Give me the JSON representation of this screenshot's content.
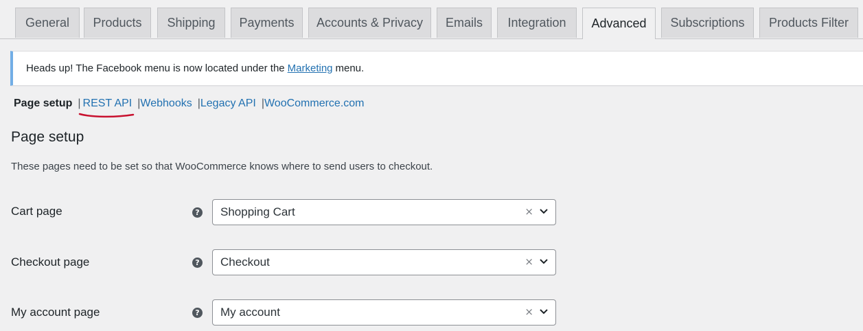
{
  "tabs": [
    {
      "label": "General"
    },
    {
      "label": "Products"
    },
    {
      "label": "Shipping"
    },
    {
      "label": "Payments"
    },
    {
      "label": "Accounts & Privacy"
    },
    {
      "label": "Emails"
    },
    {
      "label": "Integration"
    },
    {
      "label": "Advanced",
      "active": true
    },
    {
      "label": "Subscriptions"
    },
    {
      "label": "Products Filter"
    }
  ],
  "notice": {
    "before": "Heads up! The Facebook menu is now located under the",
    "link": "Marketing",
    "after": "menu."
  },
  "subnav": {
    "current": "Page setup",
    "links": [
      "REST API",
      "Webhooks",
      "Legacy API",
      "WooCommerce.com"
    ],
    "separator": "|",
    "highlight_color": "#c8102e"
  },
  "section": {
    "title": "Page setup",
    "description": "These pages need to be set so that WooCommerce knows where to send users to checkout."
  },
  "fields": [
    {
      "label": "Cart page",
      "value": "Shopping Cart",
      "help_icon": "?",
      "clear_icon": "×"
    },
    {
      "label": "Checkout page",
      "value": "Checkout",
      "help_icon": "?",
      "clear_icon": "×"
    },
    {
      "label": "My account page",
      "value": "My account",
      "help_icon": "?",
      "clear_icon": "×"
    }
  ],
  "colors": {
    "link": "#2271b1",
    "notice_accent": "#72aee6",
    "background": "#f0f0f1"
  }
}
